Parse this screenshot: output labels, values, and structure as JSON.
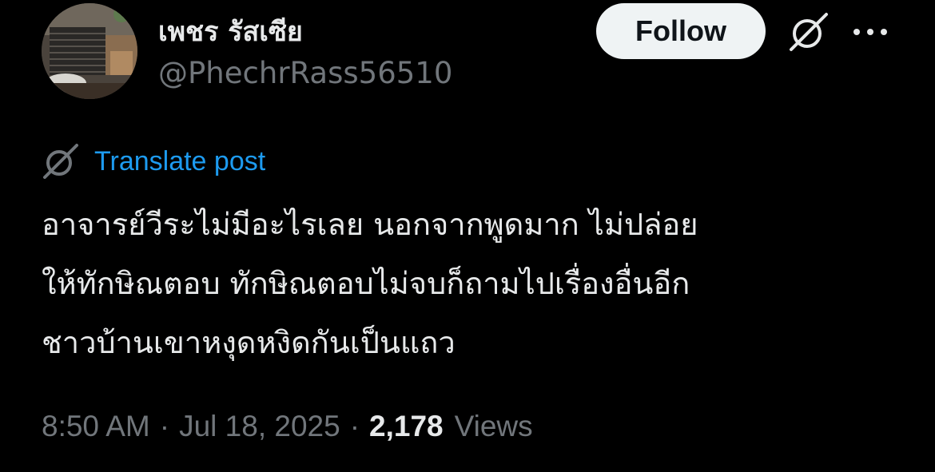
{
  "author": {
    "display_name": "เพชร รัสเซีย",
    "handle": "@PhechrRass56510",
    "avatar_icon": "profile-photo"
  },
  "actions": {
    "follow_label": "Follow",
    "grok_icon": "grok-icon",
    "more_icon": "more-icon"
  },
  "translate": {
    "icon": "grok-icon",
    "label": "Translate post"
  },
  "post": {
    "lines": [
      "อาจารย์วีระไม่มีอะไรเลย นอกจากพูดมาก ไม่ปล่อย",
      "ให้ทักษิณตอบ ทักษิณตอบไม่จบก็ถามไปเรื่องอื่นอีก",
      "ชาวบ้านเขาหงุดหงิดกันเป็นแถว"
    ]
  },
  "meta": {
    "time": "8:50 AM",
    "separator": "·",
    "date": "Jul 18, 2025",
    "views_count": "2,178",
    "views_label": "Views"
  },
  "colors": {
    "background": "#000000",
    "text_primary": "#e7e9ea",
    "text_secondary": "#71767b",
    "link": "#1d9bf0",
    "follow_bg": "#eff3f4"
  }
}
